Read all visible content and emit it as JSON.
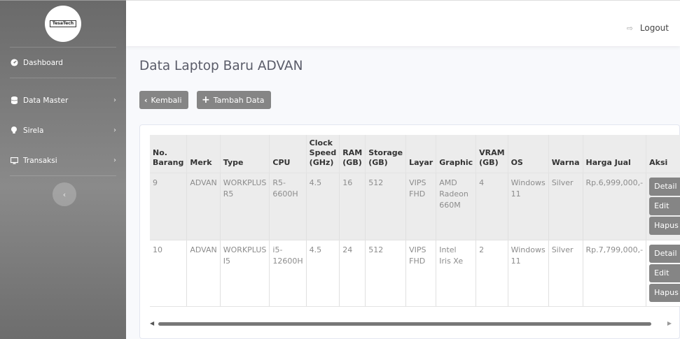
{
  "sidebar": {
    "brand": "TesaTech",
    "items": [
      {
        "label": "Dashboard",
        "icon": "tachometer-icon"
      },
      {
        "label": "Data Master",
        "icon": "database-icon"
      },
      {
        "label": "Sirela",
        "icon": "lightbulb-icon"
      },
      {
        "label": "Transaksi",
        "icon": "desktop-icon"
      }
    ]
  },
  "topbar": {
    "logout_label": "Logout"
  },
  "main": {
    "title": "Data Laptop Baru ADVAN",
    "back_label": "Kembali",
    "add_label": "Tambah Data"
  },
  "table": {
    "headers": {
      "no": [
        "No.",
        "Barang"
      ],
      "merk": "Merk",
      "type": "Type",
      "cpu": "CPU",
      "clock": [
        "Clock",
        "Speed",
        "(GHz)"
      ],
      "ram": [
        "RAM",
        "(GB)"
      ],
      "storage": [
        "Storage",
        "(GB)"
      ],
      "layar": "Layar",
      "graphic": "Graphic",
      "vram": [
        "VRAM",
        "(GB)"
      ],
      "os": "OS",
      "warna": "Warna",
      "harga": "Harga Jual",
      "aksi": "Aksi"
    },
    "rows": [
      {
        "no": "9",
        "merk": "ADVAN",
        "type": [
          "WORKPLUS",
          "R5"
        ],
        "cpu": [
          "R5-",
          "6600H"
        ],
        "clock": "4.5",
        "ram": "16",
        "storage": "512",
        "layar": [
          "VIPS",
          "FHD"
        ],
        "graphic": [
          "AMD",
          "Radeon",
          "660M"
        ],
        "vram": "4",
        "os": [
          "Windows",
          "11"
        ],
        "warna": "Silver",
        "harga": "Rp.6,999,000,-",
        "actions": [
          "Detail",
          "Edit",
          "Hapus"
        ]
      },
      {
        "no": "10",
        "merk": "ADVAN",
        "type": [
          "WORKPLUS",
          "I5"
        ],
        "cpu": [
          "i5-",
          "12600H"
        ],
        "clock": "4.5",
        "ram": "24",
        "storage": "512",
        "layar": [
          "VIPS",
          "FHD"
        ],
        "graphic": [
          "Intel",
          "Iris Xe"
        ],
        "vram": "2",
        "os": [
          "Windows",
          "11"
        ],
        "warna": "Silver",
        "harga": "Rp.7,799,000,-",
        "actions": [
          "Detail",
          "Edit",
          "Hapus"
        ]
      }
    ]
  },
  "colors": {
    "sidebar": "#7a7a7a",
    "button": "#858585",
    "table_header": "#ececec"
  }
}
